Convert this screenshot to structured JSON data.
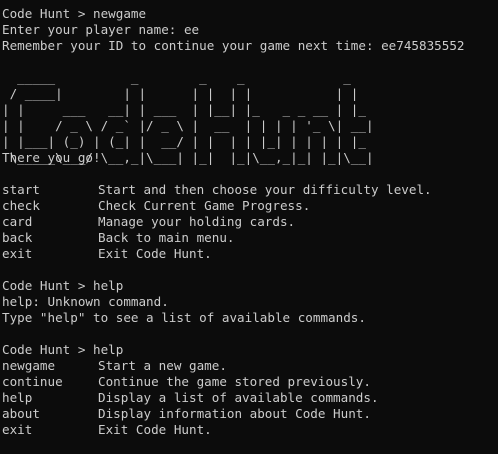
{
  "session1": {
    "prompt": "Code Hunt > newgame",
    "ask_name": "Enter your player name: ee",
    "remember": "Remember your ID to continue your game next time: ee745835552"
  },
  "banner": {
    "lines": [
      "  _____          _        _    _             _   ",
      " / ____|        | |      | |  | |           | |  ",
      "| |     ___   __| | ___  | |__| |_   _ _ __ | |_ ",
      "| |    / _ \\ / _` |/ _ \\ |  __  | | | | '_ \\| __|",
      "| |___| (_) | (_| |  __/ | |  | | |_| | | | | |_ ",
      " \\_____\\___/ \\__,_|\\___| |_|  |_|\\__,_|_| |_|\\__|"
    ],
    "ready": "There you go!"
  },
  "menu1": [
    {
      "cmd": "start",
      "desc": "Start and then choose your difficulty level."
    },
    {
      "cmd": "check",
      "desc": "Check Current Game Progress."
    },
    {
      "cmd": "card",
      "desc": "Manage your holding cards."
    },
    {
      "cmd": "back",
      "desc": "Back to main menu."
    },
    {
      "cmd": "exit",
      "desc": "Exit Code Hunt."
    }
  ],
  "session2": {
    "prompt": "Code Hunt > help",
    "error": "help: Unknown command.",
    "hint": "Type \"help\" to see a list of available commands."
  },
  "session3": {
    "prompt": "Code Hunt > help"
  },
  "menu2": [
    {
      "cmd": "newgame",
      "desc": "Start a new game."
    },
    {
      "cmd": "continue",
      "desc": "Continue the game stored previously."
    },
    {
      "cmd": "help",
      "desc": "Display a list of available commands."
    },
    {
      "cmd": "about",
      "desc": "Display information about Code Hunt."
    },
    {
      "cmd": "exit",
      "desc": "Exit Code Hunt."
    }
  ]
}
